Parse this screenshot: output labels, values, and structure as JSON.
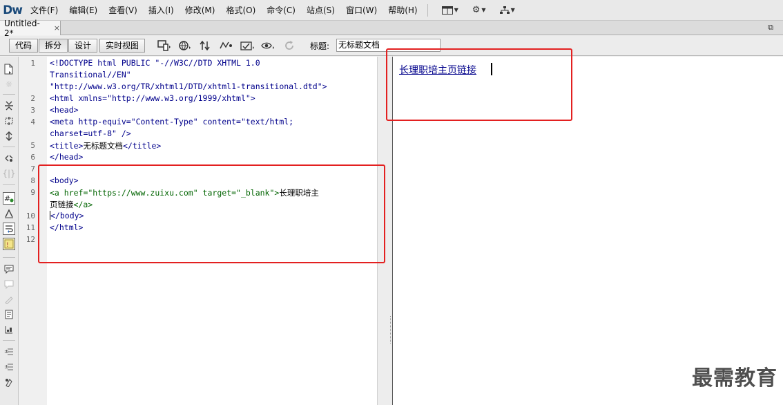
{
  "app": {
    "logo": "Dw"
  },
  "menu": {
    "items": [
      "文件(F)",
      "编辑(E)",
      "查看(V)",
      "插入(I)",
      "修改(M)",
      "格式(O)",
      "命令(C)",
      "站点(S)",
      "窗口(W)",
      "帮助(H)"
    ],
    "tools": [
      "layout-icon",
      "gear-icon",
      "site-icon"
    ]
  },
  "tabs": {
    "document": "Untitled-2*",
    "close_glyph": "×"
  },
  "toolbar": {
    "views": [
      "代码",
      "拆分",
      "设计",
      "实时视图"
    ],
    "active_view": "拆分",
    "title_label": "标题:",
    "title_value": "无标题文档"
  },
  "code": {
    "line_numbers": [
      "1",
      "",
      "",
      "2",
      "3",
      "4",
      "",
      "5",
      "6",
      "7",
      "8",
      "9",
      "",
      "10",
      "11",
      "12"
    ],
    "lines": [
      "<!DOCTYPE html PUBLIC \"-//W3C//DTD XHTML 1.0",
      "Transitional//EN\"",
      "\"http://www.w3.org/TR/xhtml1/DTD/xhtml1-transitional.dtd\">",
      "<html xmlns=\"http://www.w3.org/1999/xhtml\">",
      "<head>",
      "<meta http-equiv=\"Content-Type\" content=\"text/html;",
      "charset=utf-8\" />",
      "",
      "</head>",
      "",
      "<body>",
      "",
      "",
      "</body>",
      "</html>",
      ""
    ],
    "title_open": "<title>",
    "title_text": "无标题文档",
    "title_close": "</title>",
    "anchor_open_tag": "<a href=\"https://www.zuixu.com\" target=\"_blank\">",
    "anchor_text_1": "长理职培主",
    "anchor_text_2": "页链接",
    "anchor_close_tag": "</a>"
  },
  "design": {
    "link_text": "长理职培主页链接"
  },
  "watermark": "最需教育",
  "colors": {
    "highlight": "#e32020",
    "code_tag": "#00008b",
    "link": "#00008b"
  }
}
